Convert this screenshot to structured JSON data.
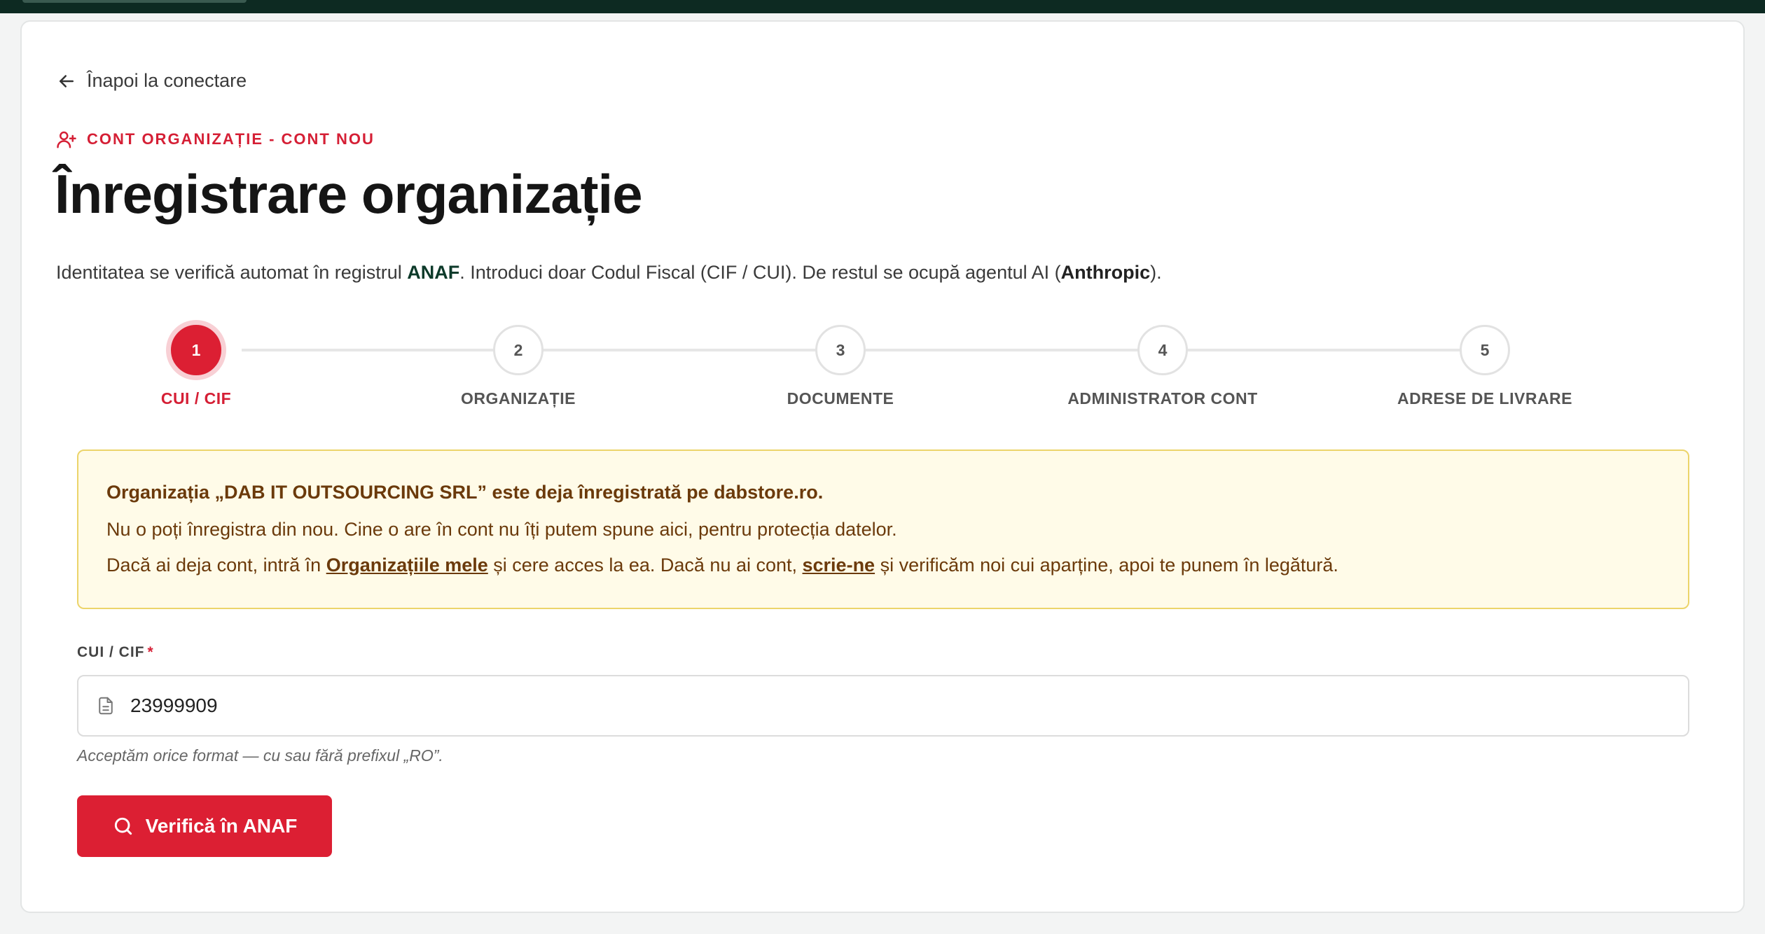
{
  "back_link": {
    "label": "Înapoi la conectare"
  },
  "eyebrow": {
    "label": "CONT ORGANIZAȚIE - CONT NOU"
  },
  "title": "Înregistrare organizație",
  "subtitle": {
    "part1": "Identitatea se verifică automat în registrul ",
    "anaf": "ANAF",
    "part2": ". Introduci doar Codul Fiscal (CIF / CUI). De restul se ocupă agentul AI (",
    "agent": "Anthropic",
    "part3": ")."
  },
  "stepper": {
    "steps": [
      {
        "number": "1",
        "label": "CUI / CIF"
      },
      {
        "number": "2",
        "label": "ORGANIZAȚIE"
      },
      {
        "number": "3",
        "label": "DOCUMENTE"
      },
      {
        "number": "4",
        "label": "ADMINISTRATOR CONT"
      },
      {
        "number": "5",
        "label": "ADRESE DE LIVRARE"
      }
    ]
  },
  "alert": {
    "title": "Organizația „DAB IT OUTSOURCING SRL” este deja înregistrată pe dabstore.ro.",
    "line1": "Nu o poți înregistra din nou. Cine o are în cont nu îți putem spune aici, pentru protecția datelor.",
    "line2_a": "Dacă ai deja cont, intră în ",
    "line2_link1": "Organizațiile mele",
    "line2_b": " și cere acces la ea. Dacă nu ai cont, ",
    "line2_link2": "scrie-ne",
    "line2_c": " și verificăm noi cui aparține, apoi te punem în legătură."
  },
  "cui_field": {
    "label": "CUI / CIF",
    "required_mark": "*",
    "value": "23999909",
    "hint": "Acceptăm orice format — cu sau fără prefixul „RO”."
  },
  "verify_button": {
    "label": "Verifică în ANAF"
  },
  "colors": {
    "accent": "#dc1f33",
    "topbar": "#0d2a22",
    "alert_bg": "#fffbe8",
    "alert_text": "#6b3a0b"
  }
}
